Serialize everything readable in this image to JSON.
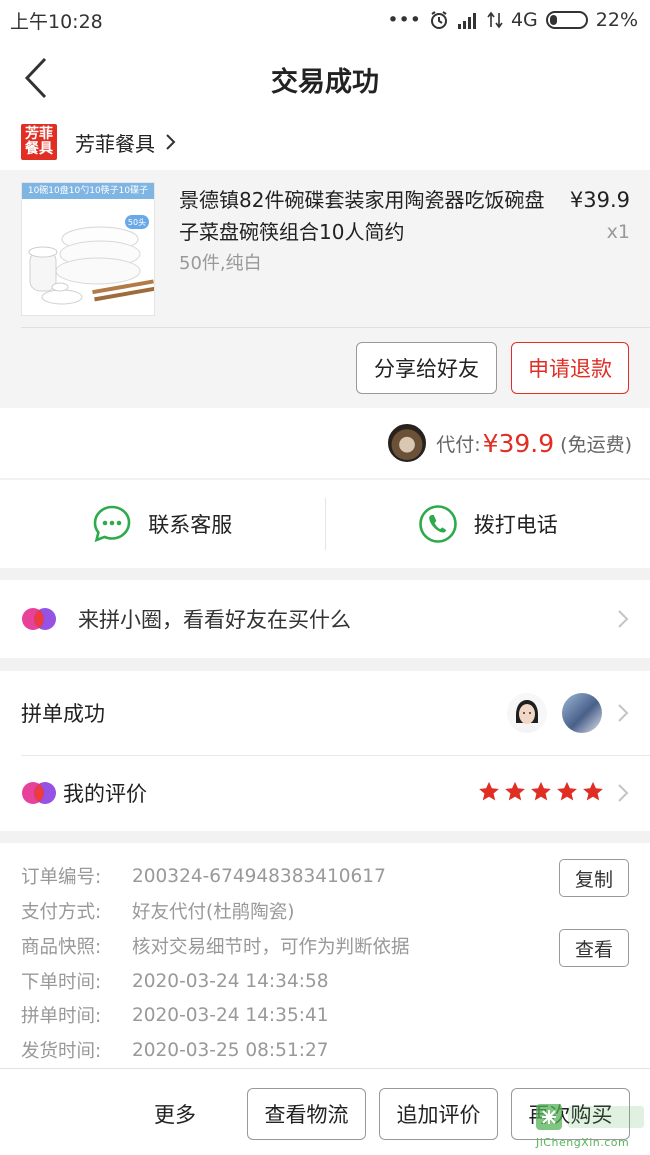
{
  "status_bar": {
    "time": "上午10:28",
    "network": "4G",
    "battery": "22%",
    "battery_level": 0.22
  },
  "header": {
    "title": "交易成功"
  },
  "store": {
    "logo_text": "芳菲餐具",
    "name": "芳菲餐具"
  },
  "product": {
    "image_banner": "10碗10盘10勺10筷子10碟子",
    "image_badge": "50头",
    "title": "景德镇82件碗碟套装家用陶瓷器吃饭碗盘子菜盘碗筷组合10人简约",
    "price": "¥39.9",
    "quantity": "x1",
    "spec": "50件,纯白",
    "share_button": "分享给好友",
    "refund_button": "申请退款"
  },
  "payment": {
    "label": "代付:",
    "amount": "¥39.9",
    "note": "(免运费)"
  },
  "contact": {
    "service_label": "联系客服",
    "phone_label": "拨打电话"
  },
  "circle": {
    "text": "来拼小圈，看看好友在买什么"
  },
  "group": {
    "label": "拼单成功",
    "review_label": "我的评价",
    "stars": 5
  },
  "order_info": {
    "rows": [
      {
        "key": "订单编号:",
        "value": "200324-674948383410617"
      },
      {
        "key": "支付方式:",
        "value": "好友代付(杜鹃陶瓷)"
      },
      {
        "key": "商品快照:",
        "value": "核对交易细节时，可作为判断依据"
      },
      {
        "key": "下单时间:",
        "value": "2020-03-24 14:34:58"
      },
      {
        "key": "拼单时间:",
        "value": "2020-03-24 14:35:41"
      },
      {
        "key": "发货时间:",
        "value": "2020-03-25 08:51:27"
      }
    ],
    "copy_button": "复制",
    "view_button": "查看"
  },
  "bottom_bar": {
    "more": "更多",
    "logistics": "查看物流",
    "add_review": "追加评价",
    "rebuy": "再次购买"
  },
  "watermark": {
    "text": "JiChengXin.com"
  },
  "colors": {
    "accent": "#e02e24",
    "green": "#2daa4b",
    "background": "#f2f2f2"
  }
}
